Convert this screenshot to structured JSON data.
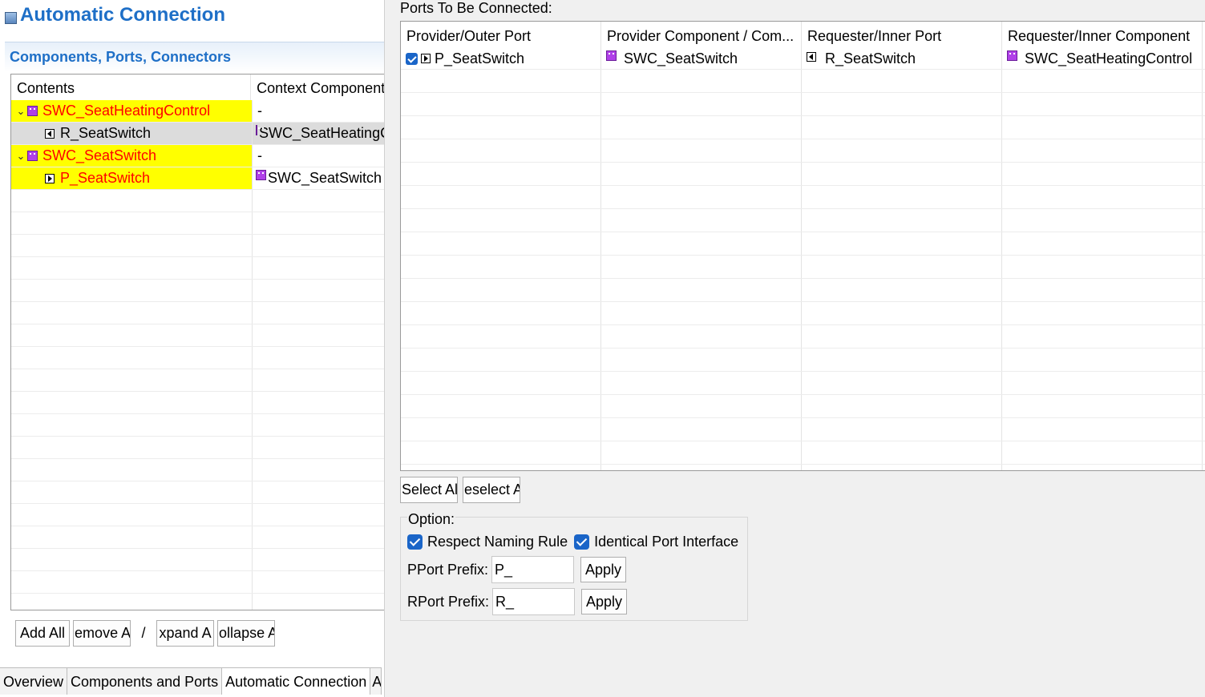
{
  "editor": {
    "title": "Automatic Connection",
    "section_header": "Components, Ports, Connectors",
    "tree": {
      "columns": [
        "Contents",
        "Context Component"
      ],
      "rows": [
        {
          "kind": "component",
          "label": "SWC_SeatHeatingControl",
          "context": "-",
          "expanded": true
        },
        {
          "kind": "port-r",
          "label": "R_SeatSwitch",
          "context": "SWC_SeatHeatingControl",
          "selected": true
        },
        {
          "kind": "component",
          "label": "SWC_SeatSwitch",
          "context": "-",
          "expanded": true
        },
        {
          "kind": "port-p",
          "label": "P_SeatSwitch",
          "context": "SWC_SeatSwitch",
          "highlighted": true
        }
      ]
    },
    "buttons": {
      "add_all": "Add All",
      "remove_all": "emove A",
      "separator": "/",
      "expand_all": "xpand A",
      "collapse_all": "ollapse A"
    },
    "tabs": [
      "Overview",
      "Components and Ports",
      "Automatic Connection",
      "A"
    ]
  },
  "dialog": {
    "ports_label": "Ports To Be Connected:",
    "table": {
      "columns": [
        "Provider/Outer Port",
        "Provider Component / Com...",
        "Requester/Inner Port",
        "Requester/Inner Component"
      ],
      "rows": [
        {
          "checked": true,
          "provider_port": "P_SeatSwitch",
          "provider_component": "SWC_SeatSwitch",
          "requester_port": "R_SeatSwitch",
          "requester_component": "SWC_SeatHeatingControl"
        }
      ]
    },
    "select_all": "Select Al",
    "deselect_all": "eselect A",
    "option": {
      "legend": "Option:",
      "respect_naming_rule": "Respect Naming Rule",
      "respect_naming_rule_checked": true,
      "identical_port_interface": "Identical Port Interface",
      "identical_port_interface_checked": true,
      "pport_prefix_label": "PPort Prefix:",
      "pport_prefix_value": "P_",
      "rport_prefix_label": "RPort Prefix:",
      "rport_prefix_value": "R_",
      "apply_label": "Apply"
    }
  },
  "colors": {
    "title_blue": "#1e6fc7",
    "highlight_yellow": "#ffff00",
    "highlight_text_red": "#ff0000",
    "component_icon_purple": "#b040e8",
    "checkbox_blue": "#1a65c8"
  }
}
